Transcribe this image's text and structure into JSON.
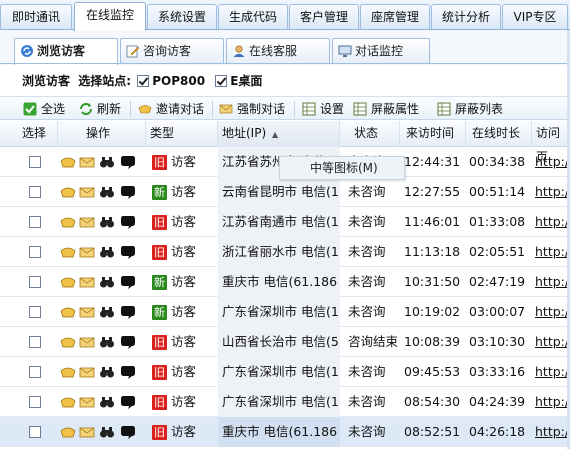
{
  "top_tabs": [
    "即时通讯",
    "在线监控",
    "系统设置",
    "生成代码",
    "客户管理",
    "座席管理",
    "统计分析",
    "VIP专区"
  ],
  "active_top_tab": 1,
  "sub_tabs": [
    {
      "label": "浏览访客",
      "icon": "refresh-arrows-icon"
    },
    {
      "label": "咨询访客",
      "icon": "edit-pencil-icon"
    },
    {
      "label": "在线客服",
      "icon": "user-agent-icon"
    },
    {
      "label": "对话监控",
      "icon": "monitor-icon"
    }
  ],
  "station_bar": {
    "prefix": "浏览访客",
    "label": "选择站点:",
    "sites": [
      {
        "name": "POP800",
        "checked": true
      },
      {
        "name": "E桌面",
        "checked": true
      }
    ]
  },
  "toolbar": [
    {
      "label": "全选",
      "icon": "green-check-icon"
    },
    {
      "label": "刷新",
      "icon": "refresh-icon"
    },
    {
      "label": "邀请对话",
      "icon": "invite-chat-icon"
    },
    {
      "label": "强制对话",
      "icon": "force-chat-icon"
    },
    {
      "label": "设置",
      "icon": "table-settings-icon"
    },
    {
      "label": "屏蔽属性",
      "icon": "block-attribute-icon"
    },
    {
      "label": "屏蔽列表",
      "icon": "block-list-icon"
    }
  ],
  "table": {
    "headers": [
      "选择",
      "操作",
      "类型",
      "地址(IP)",
      "状态",
      "来访时间",
      "在线时长",
      "访问页"
    ],
    "rows": [
      {
        "tag": "旧",
        "tag_type": "old",
        "type": "访客",
        "address": "江苏省苏州市 电信(1",
        "status": "未咨询",
        "time": "12:44:31",
        "duration": "00:34:38",
        "page": "http:/"
      },
      {
        "tag": "新",
        "tag_type": "new",
        "type": "访客",
        "address": "云南省昆明市 电信(1",
        "status": "未咨询",
        "time": "12:27:55",
        "duration": "00:51:14",
        "page": "http:/"
      },
      {
        "tag": "旧",
        "tag_type": "old",
        "type": "访客",
        "address": "江苏省南通市 电信(1",
        "status": "未咨询",
        "time": "11:46:01",
        "duration": "01:33:08",
        "page": "http:/"
      },
      {
        "tag": "旧",
        "tag_type": "old",
        "type": "访客",
        "address": "浙江省丽水市 电信(1",
        "status": "未咨询",
        "time": "11:13:18",
        "duration": "02:05:51",
        "page": "http:/"
      },
      {
        "tag": "新",
        "tag_type": "new",
        "type": "访客",
        "address": "重庆市 电信(61.186",
        "status": "未咨询",
        "time": "10:31:50",
        "duration": "02:47:19",
        "page": "http:/"
      },
      {
        "tag": "新",
        "tag_type": "new",
        "type": "访客",
        "address": "广东省深圳市 电信(1",
        "status": "未咨询",
        "time": "10:19:02",
        "duration": "03:00:07",
        "page": "http:/"
      },
      {
        "tag": "旧",
        "tag_type": "old",
        "type": "访客",
        "address": "山西省长治市 电信(5",
        "status": "咨询结束",
        "time": "10:08:39",
        "duration": "03:10:30",
        "page": "http:/"
      },
      {
        "tag": "旧",
        "tag_type": "old",
        "type": "访客",
        "address": "广东省深圳市 电信(1",
        "status": "未咨询",
        "time": "09:45:53",
        "duration": "03:33:16",
        "page": "http:/"
      },
      {
        "tag": "旧",
        "tag_type": "old",
        "type": "访客",
        "address": "广东省深圳市 电信(1",
        "status": "未咨询",
        "time": "08:54:30",
        "duration": "04:24:39",
        "page": "http:/"
      },
      {
        "tag": "旧",
        "tag_type": "old",
        "type": "访客",
        "address": "重庆市 电信(61.186",
        "status": "未咨询",
        "time": "08:52:51",
        "duration": "04:26:18",
        "page": "http:/"
      }
    ]
  },
  "tooltip": "中等图标(M)",
  "colors": {
    "old_tag": "#d9221c",
    "new_tag": "#2a8a1e",
    "tab_border": "#9fbde0"
  }
}
